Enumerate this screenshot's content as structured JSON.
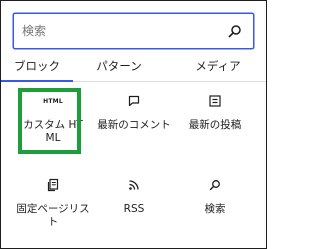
{
  "search": {
    "placeholder": "検索",
    "icon": "search-icon"
  },
  "tabs": [
    {
      "label": "ブロック",
      "active": true
    },
    {
      "label": "パターン",
      "active": false
    },
    {
      "label": "メディア",
      "active": false
    }
  ],
  "blocks": [
    {
      "label": "カスタム HTML",
      "icon": "html-icon",
      "icon_text": "HTML",
      "highlighted": true
    },
    {
      "label": "最新のコメント",
      "icon": "comment-icon"
    },
    {
      "label": "最新の投稿",
      "icon": "posts-list-icon"
    },
    {
      "label": "固定ページリスト",
      "icon": "pages-icon"
    },
    {
      "label": "RSS",
      "icon": "rss-icon"
    },
    {
      "label": "検索",
      "icon": "search-icon"
    }
  ],
  "colors": {
    "accent": "#3858e9",
    "highlight": "#1e9e3a",
    "text": "#1e1e1e",
    "border": "#dddddd"
  }
}
